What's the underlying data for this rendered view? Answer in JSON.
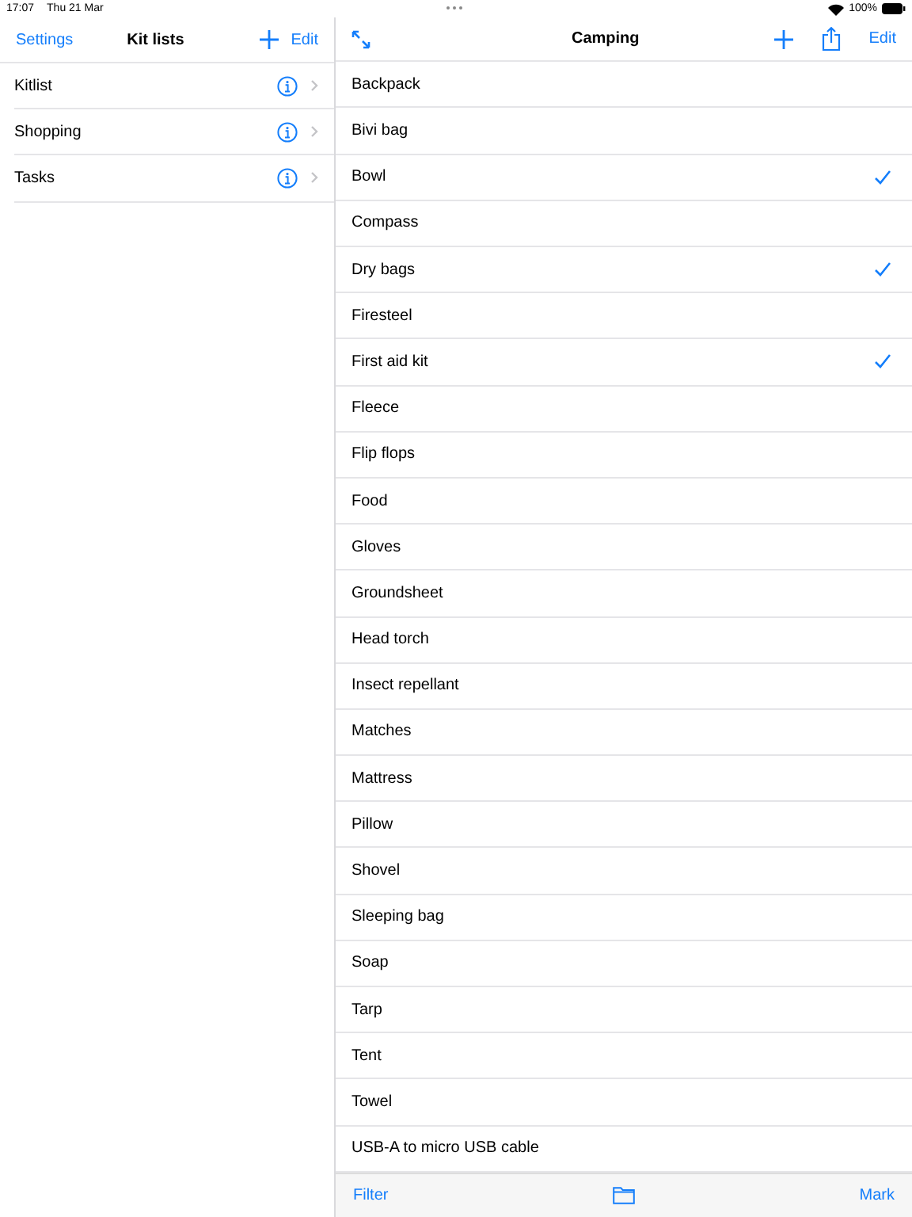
{
  "status_bar": {
    "time": "17:07",
    "date": "Thu 21 Mar",
    "battery": "100%"
  },
  "sidebar": {
    "title": "Kit lists",
    "back": "Settings",
    "edit": "Edit",
    "items": [
      {
        "name": "Kitlist"
      },
      {
        "name": "Shopping"
      },
      {
        "name": "Tasks"
      }
    ]
  },
  "detail": {
    "title": "Camping",
    "edit": "Edit",
    "items": [
      {
        "name": "Backpack",
        "checked": false
      },
      {
        "name": "Bivi bag",
        "checked": false
      },
      {
        "name": "Bowl",
        "checked": true
      },
      {
        "name": "Compass",
        "checked": false
      },
      {
        "name": "Dry bags",
        "checked": true
      },
      {
        "name": "Firesteel",
        "checked": false
      },
      {
        "name": "First aid kit",
        "checked": true
      },
      {
        "name": "Fleece",
        "checked": false
      },
      {
        "name": "Flip flops",
        "checked": false
      },
      {
        "name": "Food",
        "checked": false
      },
      {
        "name": "Gloves",
        "checked": false
      },
      {
        "name": "Groundsheet",
        "checked": false
      },
      {
        "name": "Head torch",
        "checked": false
      },
      {
        "name": "Insect repellant",
        "checked": false
      },
      {
        "name": "Matches",
        "checked": false
      },
      {
        "name": "Mattress",
        "checked": false
      },
      {
        "name": "Pillow",
        "checked": false
      },
      {
        "name": "Shovel",
        "checked": false
      },
      {
        "name": "Sleeping bag",
        "checked": false
      },
      {
        "name": "Soap",
        "checked": false
      },
      {
        "name": "Tarp",
        "checked": false
      },
      {
        "name": "Tent",
        "checked": false
      },
      {
        "name": "Towel",
        "checked": false
      },
      {
        "name": "USB-A to micro USB cable",
        "checked": false
      }
    ],
    "toolbar": {
      "filter": "Filter",
      "mark": "Mark"
    }
  }
}
